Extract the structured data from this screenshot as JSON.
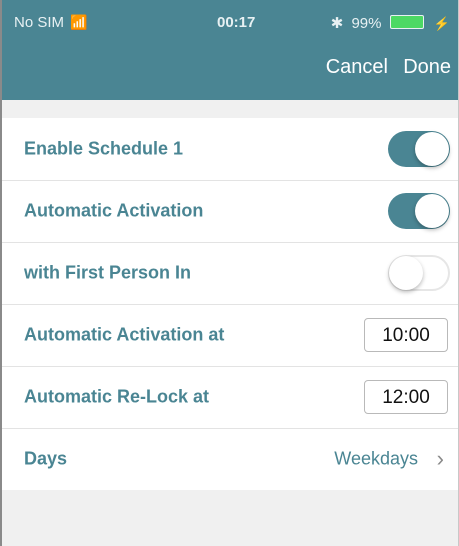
{
  "status_bar": {
    "carrier": "No SIM",
    "wifi_icon": "wifi-icon",
    "time": "00:17",
    "bluetooth_icon": "bluetooth-icon",
    "battery": "99%",
    "battery_level": 0.99
  },
  "nav": {
    "cancel_label": "Cancel",
    "done_label": "Done"
  },
  "rows": [
    {
      "label": "Enable Schedule 1",
      "type": "toggle",
      "state": true
    },
    {
      "label": "Automatic Activation",
      "type": "toggle",
      "state": true
    },
    {
      "label": "with First Person In",
      "type": "toggle",
      "state": false
    },
    {
      "label": "Automatic Activation at",
      "type": "time",
      "value": "10:00"
    },
    {
      "label": "Automatic Re-Lock at",
      "type": "time",
      "value": "12:00"
    },
    {
      "label": "Days",
      "type": "link",
      "value": "Weekdays"
    }
  ],
  "colors": {
    "accent": "#4a8593",
    "toggle_on": "#4a8593",
    "background": "#f0f0f0"
  }
}
